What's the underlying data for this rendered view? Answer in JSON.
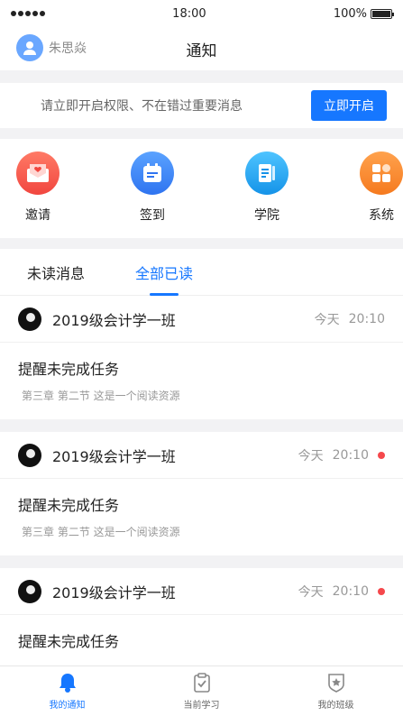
{
  "status_bar": {
    "time": "18:00",
    "battery": "100%"
  },
  "nav": {
    "user_name": "朱思焱",
    "title": "通知"
  },
  "permission": {
    "text": "请立即开启权限、不在错过重要消息",
    "button": "立即开启"
  },
  "quick_links": [
    {
      "label": "邀请",
      "icon": "envelope-icon",
      "color": "#f5564e"
    },
    {
      "label": "签到",
      "icon": "calendar-icon",
      "color": "#3f8cff"
    },
    {
      "label": "学院",
      "icon": "book-icon",
      "color": "#23a3f5"
    },
    {
      "label": "系统",
      "icon": "grid-icon",
      "color": "#fb8c2b"
    }
  ],
  "tabs": {
    "unread": "未读消息",
    "mark_all_read": "全部已读"
  },
  "messages": [
    {
      "group": "2019级会计学一班",
      "day": "今天",
      "time": "20:10",
      "title": "提醒未完成任务",
      "desc": "第三章 第二节   这是一个阅读资源",
      "unread": false
    },
    {
      "group": "2019级会计学一班",
      "day": "今天",
      "time": "20:10",
      "title": "提醒未完成任务",
      "desc": "第三章 第二节   这是一个阅读资源",
      "unread": true
    },
    {
      "group": "2019级会计学一班",
      "day": "今天",
      "time": "20:10",
      "title": "提醒未完成任务",
      "desc": "",
      "unread": true
    }
  ],
  "tabbar": [
    {
      "label": "我的通知",
      "icon": "bell-icon",
      "active": true
    },
    {
      "label": "当前学习",
      "icon": "clipboard-check-icon",
      "active": false
    },
    {
      "label": "我的班级",
      "icon": "shield-star-icon",
      "active": false
    }
  ],
  "colors": {
    "accent": "#1677ff",
    "unread_dot": "#f5484c"
  }
}
